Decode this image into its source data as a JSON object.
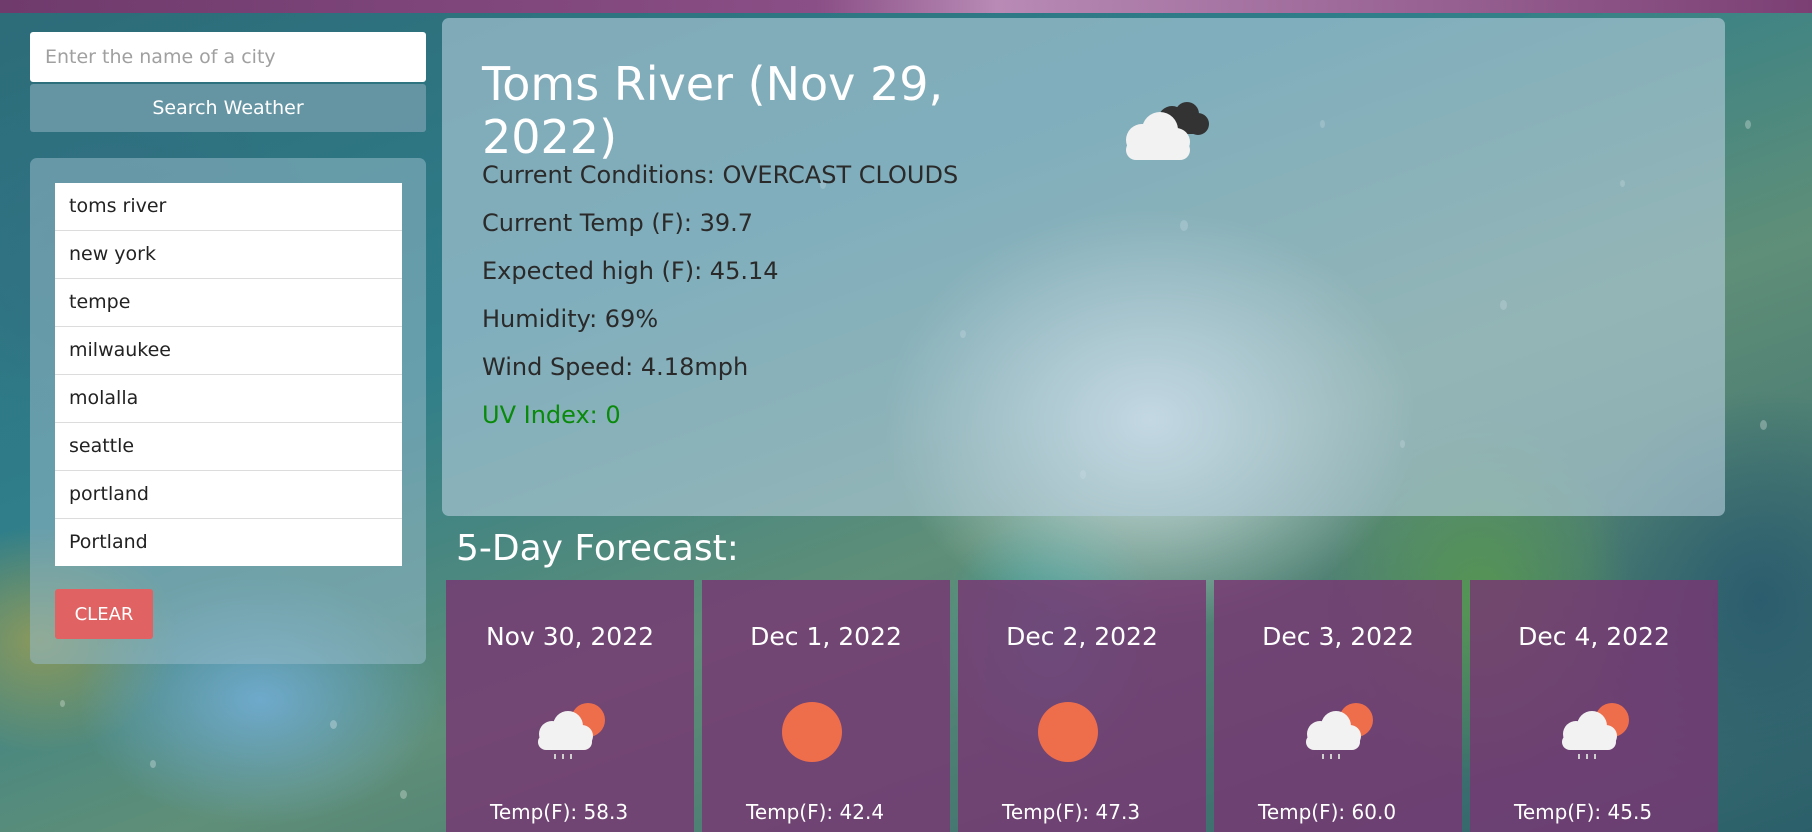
{
  "search": {
    "placeholder": "Enter the name of a city",
    "button_label": "Search Weather"
  },
  "history": {
    "items": [
      "toms river",
      "new york",
      "tempe",
      "milwaukee",
      "molalla",
      "seattle",
      "portland",
      "Portland"
    ],
    "clear_label": "CLEAR"
  },
  "current": {
    "title": "Toms River (Nov 29, 2022)",
    "icon": "overcast-clouds-icon",
    "conditions": "Current Conditions: OVERCAST CLOUDS",
    "temp": "Current Temp (F): 39.7",
    "high": "Expected high (F): 45.14",
    "humidity": "Humidity: 69%",
    "wind": "Wind Speed: 4.18mph",
    "uv": "UV Index: 0",
    "uv_color": "#0a8a0a"
  },
  "forecast": {
    "heading": "5-Day Forecast:",
    "days": [
      {
        "date": "Nov 30, 2022",
        "icon": "sun-cloud-rain-icon",
        "temp": "Temp(F): 58.3"
      },
      {
        "date": "Dec 1, 2022",
        "icon": "sun-icon",
        "temp": "Temp(F): 42.4"
      },
      {
        "date": "Dec 2, 2022",
        "icon": "sun-icon",
        "temp": "Temp(F): 47.3"
      },
      {
        "date": "Dec 3, 2022",
        "icon": "sun-cloud-rain-icon",
        "temp": "Temp(F): 60.0"
      },
      {
        "date": "Dec 4, 2022",
        "icon": "sun-cloud-rain-icon",
        "temp": "Temp(F): 45.5"
      }
    ]
  },
  "colors": {
    "accent_purple": "#7a3773",
    "clear_button": "#e06262",
    "sun": "#ee6e4c"
  }
}
